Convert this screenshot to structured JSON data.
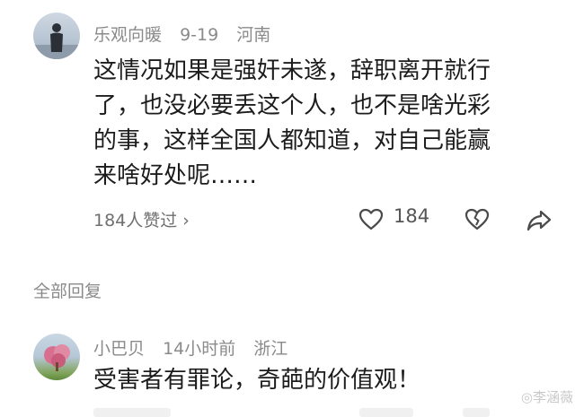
{
  "comments": [
    {
      "user": "乐观向暖",
      "date": "9-19",
      "location": "河南",
      "lines": [
        "这情况如果是强奸未遂，辞职离开就行",
        "了，也没必要丢这个人，也不是啥光彩",
        "的事，这样全国人都知道，对自己能赢",
        "来啥好处呢……"
      ],
      "liked_by": "184人赞过 ›",
      "like_count": "184"
    },
    {
      "user": "小巴贝",
      "date": "14小时前",
      "location": "浙江",
      "lines": [
        "受害者有罪论，奇葩的价值观！"
      ]
    }
  ],
  "section_label": "全部回复",
  "watermark": "◎李涵薇",
  "icons": {
    "like": "heart-icon",
    "dislike": "broken-heart-icon",
    "share": "share-icon"
  }
}
